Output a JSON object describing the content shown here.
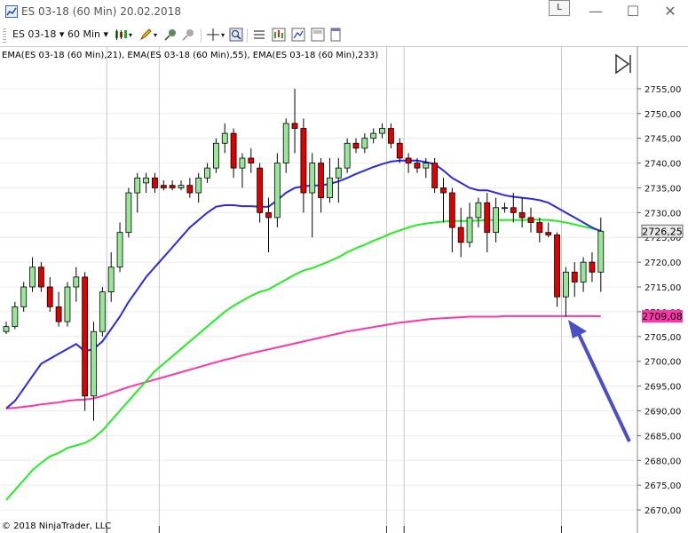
{
  "window": {
    "title": "ES 03-18 (60 Min)  20.02.2018",
    "link_label": "L",
    "minimize_glyph": "—",
    "maximize_glyph": "☐",
    "close_glyph": "✕"
  },
  "toolbar": {
    "instrument": "ES 03-18",
    "interval": "60 Min",
    "dropdown_glyph": "▾"
  },
  "colors": {
    "up_candle": "#98e698",
    "down_candle": "#e00000",
    "ema21": "#2a2ae0",
    "ema55": "#22ee22",
    "ema233": "#ff33aa",
    "last_price_tag": "#e8e8e8",
    "ema233_tag": "#ff33aa",
    "arrow": "#4a4fc8"
  },
  "chart_data": {
    "type": "candlestick",
    "indicator_label": "EMA(ES 03-18 (60 Min),21), EMA(ES 03-18 (60 Min),55), EMA(ES 03-18 (60 Min),233)",
    "copyright": "© 2018 NinjaTrader, LLC",
    "ylim": [
      2667.5,
      2760
    ],
    "yticks": [
      "2670,00",
      "2675,00",
      "2680,00",
      "2685,00",
      "2690,00",
      "2695,00",
      "2700,00",
      "2705,00",
      "2710,00",
      "2715,00",
      "2720,00",
      "2725,00",
      "2730,00",
      "2735,00",
      "2740,00",
      "2745,00",
      "2750,00",
      "2755,00"
    ],
    "ytick_values": [
      2670,
      2675,
      2680,
      2685,
      2690,
      2695,
      2700,
      2705,
      2710,
      2715,
      2720,
      2725,
      2730,
      2735,
      2740,
      2745,
      2750,
      2755
    ],
    "last_price": {
      "label": "2726,25",
      "value": 2726.25
    },
    "ema233_last": {
      "label": "2709,08",
      "value": 2709.08
    },
    "session_breaks": [
      12,
      18,
      44,
      46,
      64
    ],
    "candles": [
      {
        "o": 2706,
        "h": 2708,
        "l": 2705.5,
        "c": 2707
      },
      {
        "o": 2707,
        "h": 2712,
        "l": 2706.5,
        "c": 2711
      },
      {
        "o": 2711,
        "h": 2716,
        "l": 2710,
        "c": 2715
      },
      {
        "o": 2715,
        "h": 2721,
        "l": 2714,
        "c": 2719
      },
      {
        "o": 2719,
        "h": 2720,
        "l": 2714,
        "c": 2715
      },
      {
        "o": 2715,
        "h": 2717,
        "l": 2710,
        "c": 2711
      },
      {
        "o": 2711,
        "h": 2714,
        "l": 2707,
        "c": 2708
      },
      {
        "o": 2708,
        "h": 2716,
        "l": 2707,
        "c": 2715
      },
      {
        "o": 2715,
        "h": 2719,
        "l": 2712,
        "c": 2717
      },
      {
        "o": 2717,
        "h": 2718,
        "l": 2690,
        "c": 2693
      },
      {
        "o": 2693,
        "h": 2708,
        "l": 2688,
        "c": 2706
      },
      {
        "o": 2706,
        "h": 2715,
        "l": 2705,
        "c": 2714
      },
      {
        "o": 2714,
        "h": 2722,
        "l": 2712,
        "c": 2719
      },
      {
        "o": 2719,
        "h": 2728,
        "l": 2718,
        "c": 2726
      },
      {
        "o": 2726,
        "h": 2735,
        "l": 2725,
        "c": 2734
      },
      {
        "o": 2734,
        "h": 2738,
        "l": 2730,
        "c": 2737
      },
      {
        "o": 2736,
        "h": 2738,
        "l": 2734,
        "c": 2737
      },
      {
        "o": 2737,
        "h": 2738,
        "l": 2734,
        "c": 2735
      },
      {
        "o": 2735.5,
        "h": 2736.5,
        "l": 2734.5,
        "c": 2735
      },
      {
        "o": 2735.5,
        "h": 2736.5,
        "l": 2734.5,
        "c": 2735
      },
      {
        "o": 2735,
        "h": 2736.5,
        "l": 2734.5,
        "c": 2735.5
      },
      {
        "o": 2735.5,
        "h": 2737,
        "l": 2733,
        "c": 2734
      },
      {
        "o": 2734,
        "h": 2738,
        "l": 2732,
        "c": 2737
      },
      {
        "o": 2737,
        "h": 2740,
        "l": 2736,
        "c": 2739
      },
      {
        "o": 2739,
        "h": 2745,
        "l": 2738,
        "c": 2744
      },
      {
        "o": 2744,
        "h": 2748,
        "l": 2742,
        "c": 2746
      },
      {
        "o": 2746,
        "h": 2747,
        "l": 2737,
        "c": 2739
      },
      {
        "o": 2739,
        "h": 2742,
        "l": 2735,
        "c": 2741
      },
      {
        "o": 2741,
        "h": 2743,
        "l": 2738,
        "c": 2740
      },
      {
        "o": 2739,
        "h": 2740,
        "l": 2728,
        "c": 2730
      },
      {
        "o": 2730,
        "h": 2733,
        "l": 2722,
        "c": 2729
      },
      {
        "o": 2729,
        "h": 2742,
        "l": 2727,
        "c": 2740
      },
      {
        "o": 2740,
        "h": 2749,
        "l": 2738,
        "c": 2748
      },
      {
        "o": 2748,
        "h": 2755,
        "l": 2742,
        "c": 2747
      },
      {
        "o": 2747,
        "h": 2749,
        "l": 2730,
        "c": 2734
      },
      {
        "o": 2734,
        "h": 2742,
        "l": 2725,
        "c": 2740
      },
      {
        "o": 2740,
        "h": 2741,
        "l": 2730,
        "c": 2733
      },
      {
        "o": 2733,
        "h": 2741,
        "l": 2732,
        "c": 2737
      },
      {
        "o": 2737,
        "h": 2741,
        "l": 2732,
        "c": 2739
      },
      {
        "o": 2739,
        "h": 2745,
        "l": 2738,
        "c": 2744
      },
      {
        "o": 2744,
        "h": 2745,
        "l": 2742,
        "c": 2743
      },
      {
        "o": 2743,
        "h": 2746,
        "l": 2742,
        "c": 2745
      },
      {
        "o": 2745,
        "h": 2747,
        "l": 2744,
        "c": 2746
      },
      {
        "o": 2746,
        "h": 2748,
        "l": 2745,
        "c": 2747
      },
      {
        "o": 2747,
        "h": 2748,
        "l": 2743,
        "c": 2744
      },
      {
        "o": 2744,
        "h": 2745,
        "l": 2740,
        "c": 2741
      },
      {
        "o": 2741,
        "h": 2742,
        "l": 2738,
        "c": 2740
      },
      {
        "o": 2740,
        "h": 2741,
        "l": 2738,
        "c": 2739
      },
      {
        "o": 2739,
        "h": 2741,
        "l": 2737,
        "c": 2740
      },
      {
        "o": 2740,
        "h": 2741,
        "l": 2734,
        "c": 2735
      },
      {
        "o": 2735,
        "h": 2737,
        "l": 2728,
        "c": 2734
      },
      {
        "o": 2734,
        "h": 2735,
        "l": 2722,
        "c": 2727
      },
      {
        "o": 2727,
        "h": 2731,
        "l": 2721,
        "c": 2724
      },
      {
        "o": 2724,
        "h": 2732,
        "l": 2723,
        "c": 2729
      },
      {
        "o": 2729,
        "h": 2733,
        "l": 2727,
        "c": 2732
      },
      {
        "o": 2732,
        "h": 2734,
        "l": 2722,
        "c": 2726
      },
      {
        "o": 2726,
        "h": 2733,
        "l": 2724,
        "c": 2731
      },
      {
        "o": 2731,
        "h": 2732,
        "l": 2730,
        "c": 2731
      },
      {
        "o": 2731,
        "h": 2734,
        "l": 2728,
        "c": 2730
      },
      {
        "o": 2730,
        "h": 2733,
        "l": 2727,
        "c": 2729
      },
      {
        "o": 2729,
        "h": 2731,
        "l": 2726,
        "c": 2728
      },
      {
        "o": 2728,
        "h": 2729,
        "l": 2724,
        "c": 2726
      },
      {
        "o": 2726,
        "h": 2728,
        "l": 2725,
        "c": 2725.5
      },
      {
        "o": 2725.5,
        "h": 2726,
        "l": 2711,
        "c": 2713
      },
      {
        "o": 2713,
        "h": 2719,
        "l": 2709,
        "c": 2718
      },
      {
        "o": 2718,
        "h": 2720,
        "l": 2713,
        "c": 2716
      },
      {
        "o": 2716,
        "h": 2721,
        "l": 2714,
        "c": 2720
      },
      {
        "o": 2720,
        "h": 2722,
        "l": 2716,
        "c": 2718
      },
      {
        "o": 2718,
        "h": 2729,
        "l": 2714,
        "c": 2726.25
      }
    ],
    "ema21": [
      2690.5,
      2692,
      2694.5,
      2697,
      2699.5,
      2700.5,
      2701.5,
      2702.5,
      2703.5,
      2702,
      2702.5,
      2704,
      2706.5,
      2709,
      2712,
      2714.5,
      2717,
      2719,
      2721,
      2723,
      2725,
      2727,
      2728.5,
      2730,
      2731.2,
      2731.5,
      2731.5,
      2731.3,
      2731.3,
      2731.2,
      2731.2,
      2732.5,
      2734,
      2735,
      2735.3,
      2735.5,
      2735.5,
      2735.8,
      2736.3,
      2737,
      2737.8,
      2738.5,
      2739.2,
      2739.8,
      2740.3,
      2740.5,
      2740.5,
      2740.5,
      2740.2,
      2739.8,
      2738.5,
      2737,
      2736,
      2735,
      2734.5,
      2734.5,
      2734,
      2733.5,
      2733.2,
      2733,
      2732.8,
      2732.5,
      2732,
      2731,
      2730,
      2729,
      2728,
      2727,
      2726.2
    ],
    "ema55": [
      2672,
      2674,
      2676,
      2678,
      2679.5,
      2680.8,
      2681.5,
      2682.5,
      2683,
      2683.5,
      2684.5,
      2686,
      2688,
      2690,
      2692,
      2694,
      2696,
      2698,
      2699.5,
      2701,
      2702.5,
      2704,
      2705.5,
      2707,
      2708.5,
      2710,
      2711.2,
      2712.2,
      2713.2,
      2714,
      2714.5,
      2715.5,
      2716.5,
      2717.5,
      2718.3,
      2718.8,
      2719.5,
      2720.2,
      2721,
      2722,
      2722.8,
      2723.5,
      2724.3,
      2725,
      2725.8,
      2726.4,
      2727,
      2727.5,
      2727.8,
      2728,
      2728.2,
      2728.3,
      2728.3,
      2728.3,
      2728.4,
      2728.5,
      2728.5,
      2728.5,
      2728.5,
      2728.5,
      2728.6,
      2728.6,
      2728.5,
      2728.3,
      2728,
      2727.6,
      2727.2,
      2726.8,
      2726.4
    ],
    "ema233": [
      2690.5,
      2690.6,
      2690.8,
      2691,
      2691.3,
      2691.5,
      2691.7,
      2692,
      2692.2,
      2692.3,
      2692.5,
      2693,
      2693.6,
      2694.2,
      2694.8,
      2695.3,
      2695.8,
      2696.3,
      2696.8,
      2697.3,
      2697.8,
      2698.3,
      2698.8,
      2699.3,
      2699.8,
      2700.3,
      2700.7,
      2701.2,
      2701.6,
      2702,
      2702.4,
      2702.8,
      2703.2,
      2703.6,
      2704,
      2704.4,
      2704.8,
      2705.2,
      2705.6,
      2706,
      2706.3,
      2706.6,
      2706.9,
      2707.2,
      2707.5,
      2707.8,
      2708,
      2708.2,
      2708.4,
      2708.6,
      2708.7,
      2708.8,
      2708.9,
      2709,
      2709,
      2709,
      2709,
      2709.1,
      2709.1,
      2709.1,
      2709.1,
      2709.1,
      2709.1,
      2709.1,
      2709.1,
      2709.1,
      2709.1,
      2709.1,
      2709.08
    ]
  }
}
